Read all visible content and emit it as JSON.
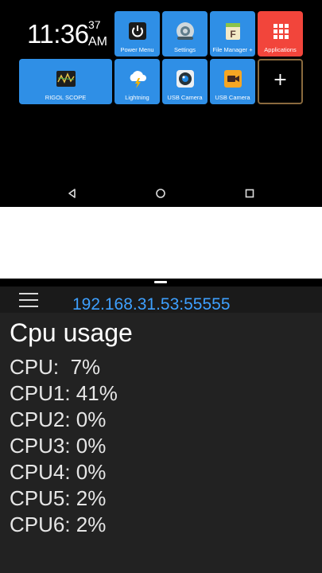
{
  "launcher": {
    "clock": {
      "time": "11:36",
      "seconds": "37",
      "ampm": "AM"
    },
    "tiles": [
      {
        "label": "Power Menu",
        "icon": "power-icon"
      },
      {
        "label": "Settings",
        "icon": "settings-icon"
      },
      {
        "label": "File Manager +",
        "icon": "file-manager-icon"
      },
      {
        "label": "Applications",
        "icon": "apps-grid-icon",
        "color": "#f2453b"
      },
      {
        "label": "RIGOL SCOPE",
        "icon": "oscilloscope-icon"
      },
      {
        "label": "Lightning",
        "icon": "cloud-lightning-icon"
      },
      {
        "label": "USB Camera",
        "icon": "usb-camera-icon"
      },
      {
        "label": "USB Camera",
        "icon": "video-camera-icon"
      }
    ],
    "add_symbol": "+",
    "tile_color": "#2f8fe6"
  },
  "navbar": {
    "buttons": [
      "back",
      "home",
      "recents"
    ]
  },
  "monitor": {
    "address": "192.168.31.53:55555",
    "title": "Cpu usage",
    "cpus": [
      "CPU:  7%",
      "CPU1: 41%",
      "CPU2: 0%",
      "CPU3: 0%",
      "CPU4: 0%",
      "CPU5: 2%",
      "CPU6: 2%"
    ],
    "accent": "#3ea0ff"
  }
}
